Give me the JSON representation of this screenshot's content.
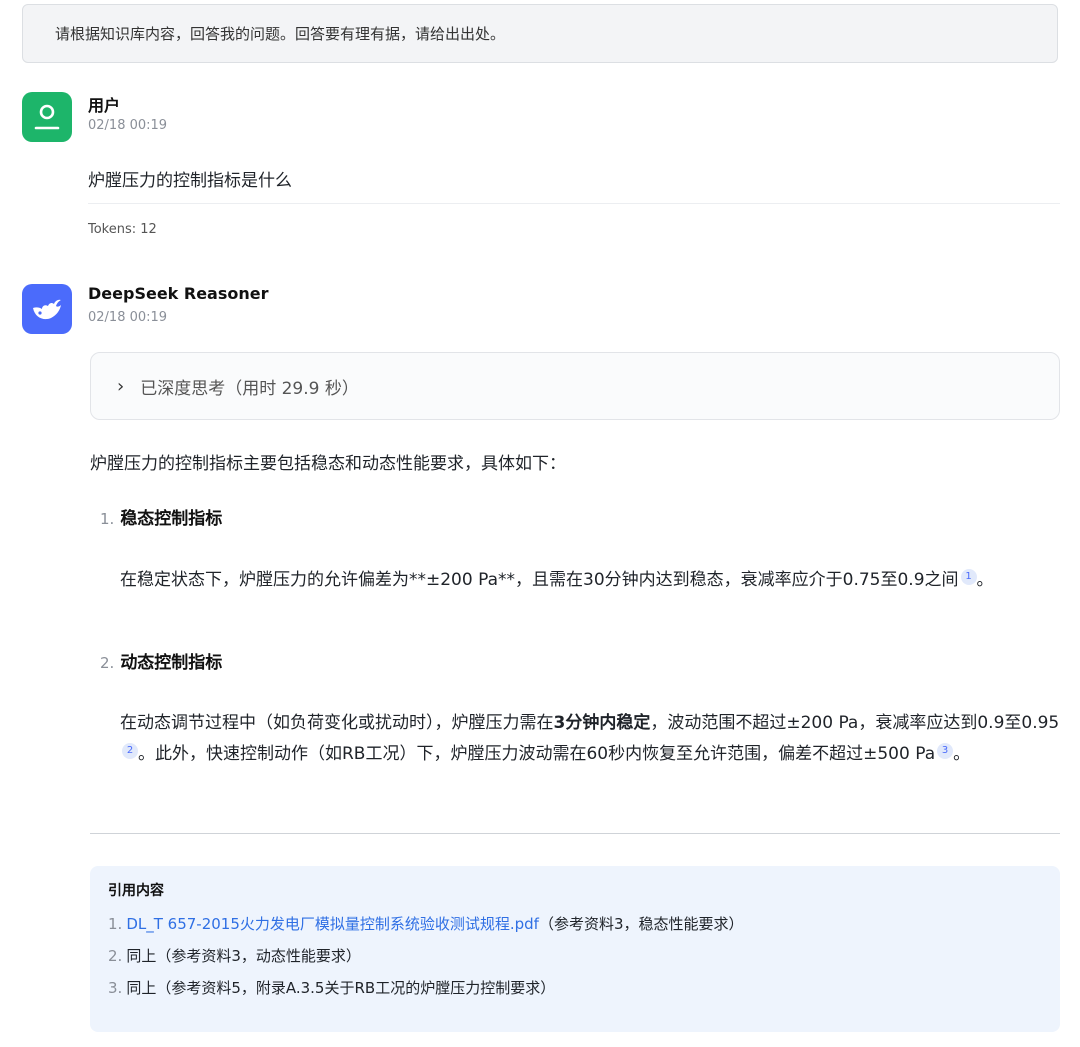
{
  "system_prompt": "请根据知识库内容，回答我的问题。回答要有理有据，请给出出处。",
  "user": {
    "name": "用户",
    "time": "02/18 00:19",
    "message": "炉膛压力的控制指标是什么",
    "tokens": "Tokens: 12",
    "avatar_icon": "user-icon",
    "avatar_color": "#1db56a"
  },
  "bot": {
    "name": "DeepSeek Reasoner",
    "time": "02/18 00:19",
    "avatar_icon": "whale-icon",
    "avatar_color": "#4b6bfb",
    "thinking": "已深度思考（用时 29.9 秒）",
    "intro": "炉膛压力的控制指标主要包括稳态和动态性能要求，具体如下：",
    "items": [
      {
        "num": "1.",
        "title": "稳态控制指标",
        "body_a": "在稳定状态下，炉膛压力的允许偏差为**±200 Pa**，且需在30分钟内达到稳态，衰减率应介于0.75至0.9之间",
        "cite": "1",
        "body_b": "。"
      },
      {
        "num": "2.",
        "title": "动态控制指标",
        "body_a": "在动态调节过程中（如负荷变化或扰动时），炉膛压力需在",
        "bold": "3分钟内稳定",
        "body_b": "，波动范围不超过±200 Pa，衰减率应达到0.9至0.95",
        "cite_a": "2",
        "body_c": "。此外，快速控制动作（如RB工况）下，炉膛压力波动需在60秒内恢复至允许范围，偏差不超过±500 Pa",
        "cite_b": "3",
        "body_d": "。"
      }
    ],
    "references": {
      "title": "引用内容",
      "rows": [
        {
          "num": "1.",
          "link": "DL_T 657-2015火力发电厂模拟量控制系统验收测试规程.pdf",
          "text": "（参考资料3，稳态性能要求）"
        },
        {
          "num": "2.",
          "text": "同上（参考资料3，动态性能要求）"
        },
        {
          "num": "3.",
          "text": "同上（参考资料5，附录A.3.5关于RB工况的炉膛压力控制要求）"
        }
      ]
    }
  }
}
